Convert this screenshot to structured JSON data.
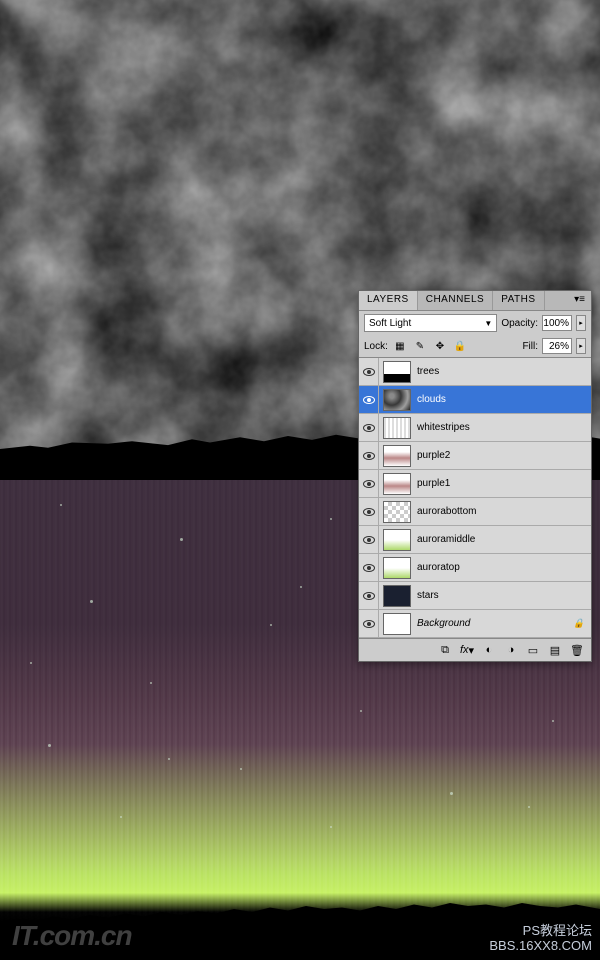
{
  "panel": {
    "tabs": {
      "layers": "LAYERS",
      "channels": "CHANNELS",
      "paths": "PATHS"
    },
    "blend_mode": "Soft Light",
    "opacity_label": "Opacity:",
    "opacity_value": "100%",
    "lock_label": "Lock:",
    "fill_label": "Fill:",
    "fill_value": "26%"
  },
  "layers": [
    {
      "name": "trees",
      "selected": false,
      "thumb": "treeline"
    },
    {
      "name": "clouds",
      "selected": true,
      "thumb": "clouds"
    },
    {
      "name": "whitestripes",
      "selected": false,
      "thumb": "stripes"
    },
    {
      "name": "purple2",
      "selected": false,
      "thumb": "purple"
    },
    {
      "name": "purple1",
      "selected": false,
      "thumb": "purple"
    },
    {
      "name": "aurorabottom",
      "selected": false,
      "thumb": "checker"
    },
    {
      "name": "auroramiddle",
      "selected": false,
      "thumb": "green"
    },
    {
      "name": "auroratop",
      "selected": false,
      "thumb": "green"
    },
    {
      "name": "stars",
      "selected": false,
      "thumb": "dark"
    },
    {
      "name": "Background",
      "selected": false,
      "thumb": "white",
      "locked": true,
      "italic": true
    }
  ],
  "watermark": {
    "left": "IT.com.cn",
    "right_line1": "PS教程论坛",
    "right_line2": "BBS.16XX8.COM"
  }
}
